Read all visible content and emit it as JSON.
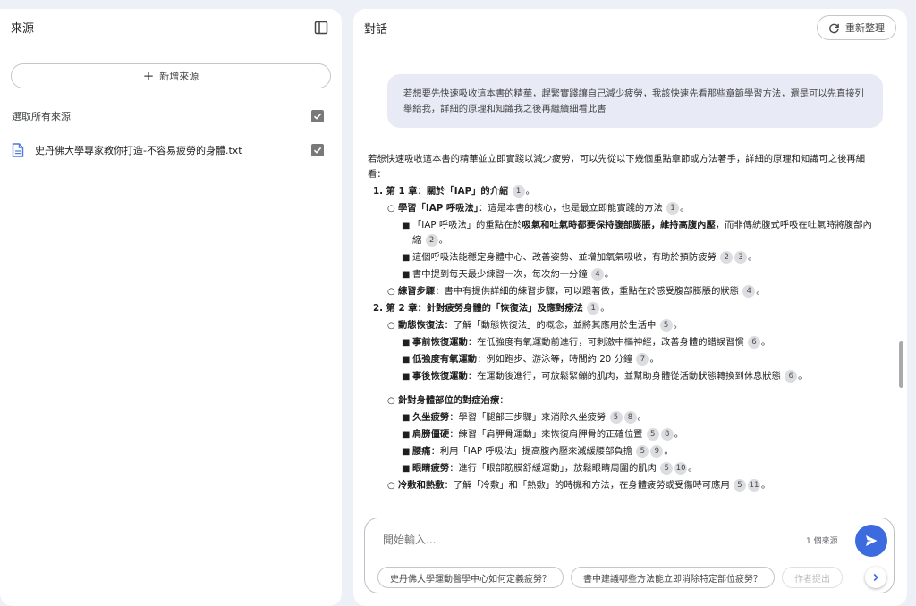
{
  "sources": {
    "title": "來源",
    "add_label": "新增來源",
    "select_all_label": "選取所有來源",
    "files": [
      {
        "name": "史丹佛大學專家教你打造-不容易疲勞的身體.txt"
      }
    ]
  },
  "chat": {
    "title": "對話",
    "refresh_label": "重新整理",
    "user_message": "若想要先快速吸收這本書的精華，趕緊實踐讓自己減少疲勞，我該快速先看那些章節學習方法，還是可以先直接列舉給我，詳細的原理和知識我之後再繼續細看此書",
    "answer_intro": "若想快速吸收這本書的精華並立即實踐以減少疲勞，可以先從以下幾個重點章節或方法著手，詳細的原理和知識可之後再細看：",
    "ch1": {
      "head": "1. 第 1 章：關於「IAP」的介紹",
      "c": "1",
      "a": {
        "head": "學習「IAP 呼吸法」",
        "body": "：這是本書的核心，也是最立即能實踐的方法",
        "c": "1",
        "i1_pre": "「IAP 呼吸法」的重點在於",
        "i1_bold": "吸氣和吐氣時都要保持腹部膨脹，維持高腹內壓",
        "i1_post": "，而非傳統腹式呼吸在吐氣時將腹部內縮",
        "i1_c": "2",
        "i2": "這個呼吸法能穩定身體中心、改善姿勢、並增加氧氣吸收，有助於預防疲勞",
        "i2_c1": "2",
        "i2_c2": "3",
        "i3": "書中提到每天最少練習一次，每次約一分鐘",
        "i3_c": "4"
      },
      "b": {
        "head": "練習步驟",
        "body": "：書中有提供詳細的練習步驟，可以跟著做，重點在於感受腹部膨脹的狀態",
        "c": "4"
      }
    },
    "ch2": {
      "head": "2. 第 2 章：針對疲勞身體的「恢復法」及應對療法",
      "c": "1",
      "a": {
        "head": "動態恢復法",
        "body": "：了解「動態恢復法」的概念，並將其應用於生活中",
        "c": "5",
        "i1_h": "事前恢復運動",
        "i1": "：在低強度有氧運動前進行，可刺激中樞神經，改善身體的錯誤習慣",
        "i1_c": "6",
        "i2_h": "低強度有氧運動",
        "i2": "：例如跑步、游泳等，時間約 20 分鐘",
        "i2_c": "7",
        "i3_h": "事後恢復運動",
        "i3": "：在運動後進行，可放鬆緊繃的肌肉，並幫助身體從活動狀態轉換到休息狀態",
        "i3_c": "6"
      },
      "b": {
        "head": "針對身體部位的對症治療",
        "body": "：",
        "i1_h": "久坐疲勞",
        "i1": "：學習「腿部三步驟」來消除久坐疲勞",
        "i1_c1": "5",
        "i1_c2": "8",
        "i2_h": "肩膀僵硬",
        "i2": "：練習「肩胛骨運動」來恢復肩胛骨的正確位置",
        "i2_c1": "5",
        "i2_c2": "8",
        "i3_h": "腰痛",
        "i3": "：利用「IAP 呼吸法」提高腹內壓來減緩腰部負擔",
        "i3_c1": "5",
        "i3_c2": "9",
        "i4_h": "眼睛疲勞",
        "i4": "：進行「眼部筋膜舒緩運動」，放鬆眼睛周圍的肌肉",
        "i4_c1": "5",
        "i4_c2": "10"
      },
      "c_row": {
        "head": "冷敷和熱敷",
        "body": "：了解「冷敷」和「熱敷」的時機和方法，在身體疲勞或受傷時可應用",
        "c1": "5",
        "c2": "11"
      }
    },
    "composer": {
      "placeholder": "開始輸入...",
      "source_count": "1 個來源"
    },
    "suggestions": [
      "史丹佛大學運動醫學中心如何定義疲勞？",
      "書中建議哪些方法能立即消除特定部位疲勞？",
      "作者提出"
    ]
  },
  "colors": {
    "accent": "#3b6bdf",
    "user_bubble": "#e8eaf6",
    "background": "#eef0f7"
  }
}
